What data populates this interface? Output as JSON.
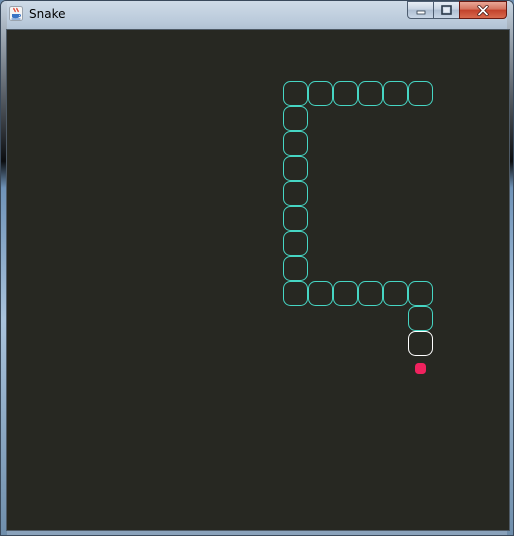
{
  "window": {
    "title": "Snake",
    "app_icon": "java-coffee-cup-icon",
    "controls": {
      "minimize_icon": "minimize-icon",
      "maximize_icon": "maximize-icon",
      "close_icon": "close-icon"
    }
  },
  "game": {
    "background_color": "#272822",
    "snake_body_color": "#46d6c4",
    "snake_head_color": "#ffffff",
    "food_color": "#f0225e",
    "grid_cell_units": 25,
    "snake": [
      {
        "col": 16,
        "row": 12,
        "part": "head"
      },
      {
        "col": 16,
        "row": 11,
        "part": "body"
      },
      {
        "col": 16,
        "row": 10,
        "part": "body"
      },
      {
        "col": 15,
        "row": 10,
        "part": "body"
      },
      {
        "col": 14,
        "row": 10,
        "part": "body"
      },
      {
        "col": 13,
        "row": 10,
        "part": "body"
      },
      {
        "col": 12,
        "row": 10,
        "part": "body"
      },
      {
        "col": 11,
        "row": 10,
        "part": "body"
      },
      {
        "col": 11,
        "row": 9,
        "part": "body"
      },
      {
        "col": 11,
        "row": 8,
        "part": "body"
      },
      {
        "col": 11,
        "row": 7,
        "part": "body"
      },
      {
        "col": 11,
        "row": 6,
        "part": "body"
      },
      {
        "col": 11,
        "row": 5,
        "part": "body"
      },
      {
        "col": 11,
        "row": 4,
        "part": "body"
      },
      {
        "col": 11,
        "row": 3,
        "part": "body"
      },
      {
        "col": 11,
        "row": 2,
        "part": "body"
      },
      {
        "col": 12,
        "row": 2,
        "part": "body"
      },
      {
        "col": 13,
        "row": 2,
        "part": "body"
      },
      {
        "col": 14,
        "row": 2,
        "part": "body"
      },
      {
        "col": 15,
        "row": 2,
        "part": "body"
      },
      {
        "col": 16,
        "row": 2,
        "part": "body"
      }
    ],
    "food": {
      "col": 16,
      "row": 13
    }
  }
}
